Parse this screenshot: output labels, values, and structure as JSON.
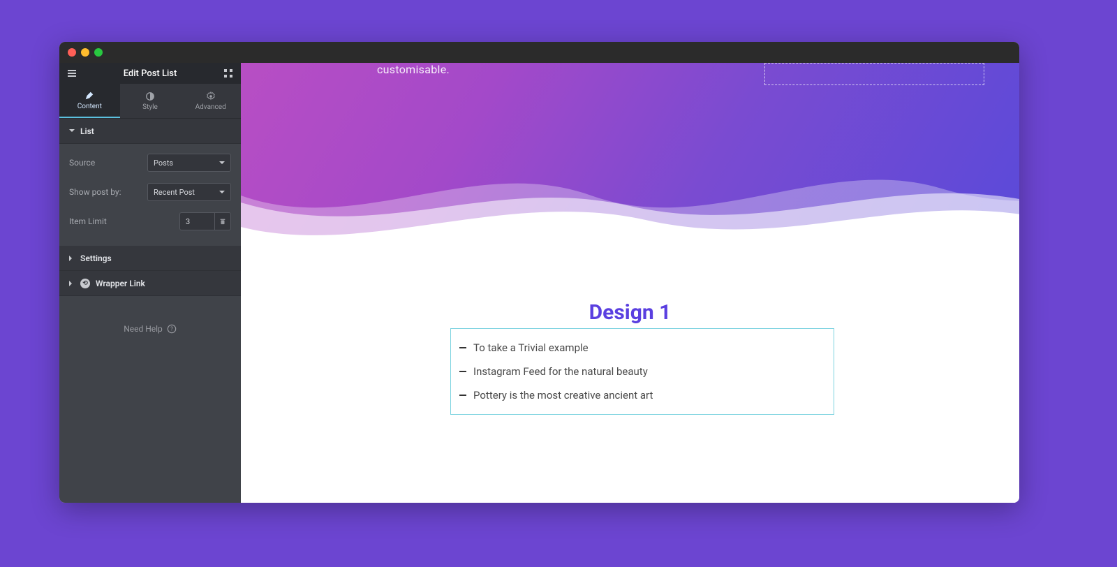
{
  "sidebar": {
    "title": "Edit Post List",
    "tabs": {
      "content": "Content",
      "style": "Style",
      "advanced": "Advanced"
    },
    "sections": {
      "list": {
        "title": "List",
        "source_label": "Source",
        "source_value": "Posts",
        "show_by_label": "Show post by:",
        "show_by_value": "Recent Post",
        "limit_label": "Item Limit",
        "limit_value": "3"
      },
      "settings_title": "Settings",
      "wrapper_title": "Wrapper Link"
    },
    "help": "Need Help"
  },
  "preview": {
    "hero_text": "customisable.",
    "design_title": "Design 1",
    "posts": [
      "To take a Trivial example",
      "Instagram Feed for the natural beauty",
      "Pottery is the most creative ancient art"
    ]
  }
}
